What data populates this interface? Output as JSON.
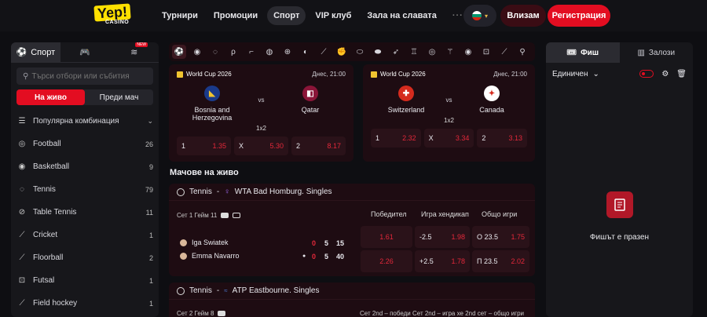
{
  "header": {
    "logo_text": "Yep!",
    "logo_sub": "CASINO",
    "nav": [
      "Турнири",
      "Промоции",
      "Спорт",
      "VIP клуб",
      "Зала на славата"
    ],
    "nav_more": "···",
    "login_label": "Влизам",
    "register_label": "Регистрация"
  },
  "left": {
    "tab_sport": "Спорт",
    "tab_new_badge": "NEW",
    "search_placeholder": "Търси отбори или събития",
    "live_label": "На живо",
    "prematch_label": "Преди мач",
    "sports": [
      {
        "name": "Популярна комбинация",
        "count": ""
      },
      {
        "name": "Football",
        "count": "26"
      },
      {
        "name": "Basketball",
        "count": "9"
      },
      {
        "name": "Tennis",
        "count": "79"
      },
      {
        "name": "Table Tennis",
        "count": "11"
      },
      {
        "name": "Cricket",
        "count": "1"
      },
      {
        "name": "Floorball",
        "count": "2"
      },
      {
        "name": "Futsal",
        "count": "1"
      },
      {
        "name": "Field hockey",
        "count": "1"
      }
    ]
  },
  "upcoming": [
    {
      "competition": "World Cup 2026",
      "time": "Днес, 21:00",
      "home": "Bosnia and Herzegovina",
      "away": "Qatar",
      "vs": "vs",
      "market": "1x2",
      "odds": [
        {
          "label": "1",
          "value": "1.35"
        },
        {
          "label": "X",
          "value": "5.30"
        },
        {
          "label": "2",
          "value": "8.17"
        }
      ]
    },
    {
      "competition": "World Cup 2026",
      "time": "Днес, 21:00",
      "home": "Switzerland",
      "away": "Canada",
      "vs": "vs",
      "market": "1x2",
      "odds": [
        {
          "label": "1",
          "value": "2.32"
        },
        {
          "label": "X",
          "value": "3.34"
        },
        {
          "label": "2",
          "value": "3.13"
        }
      ]
    }
  ],
  "live": {
    "title": "Мачове на живо",
    "match1": {
      "sport": "Tennis",
      "sep": "-",
      "tournament": "WTA Bad Homburg. Singles",
      "status": "Сет 1 Гейм 11",
      "col_winner": "Победител",
      "col_handicap": "Игра хендикап",
      "col_total": "Общо игри",
      "players": [
        {
          "name": "Iga Swiatek",
          "s1": "0",
          "s2": "5",
          "s3": "15",
          "win": "1.61",
          "hcp": "-2.5",
          "hcp_odd": "1.98",
          "tot": "О 23.5",
          "tot_odd": "1.75"
        },
        {
          "name": "Emma Navarro",
          "s1": "0",
          "s2": "5",
          "s3": "40",
          "win": "2.26",
          "hcp": "+2.5",
          "hcp_odd": "1.78",
          "tot": "П 23.5",
          "tot_odd": "2.02"
        }
      ]
    },
    "match2": {
      "sport": "Tennis",
      "sep": "-",
      "tournament": "ATP Eastbourne. Singles",
      "status": "Сет 2 Гейм 8",
      "cols": "Сет 2nd – победи Сет 2nd – игра хе 2nd сет – общо игри"
    }
  },
  "slip": {
    "tab_slip": "Фиш",
    "tab_bets": "Залози",
    "mode": "Единичен",
    "empty": "Фишът е празен"
  },
  "colors": {
    "accent": "#e30d21",
    "odds": "#e3283a",
    "brand": "#ffe000"
  }
}
